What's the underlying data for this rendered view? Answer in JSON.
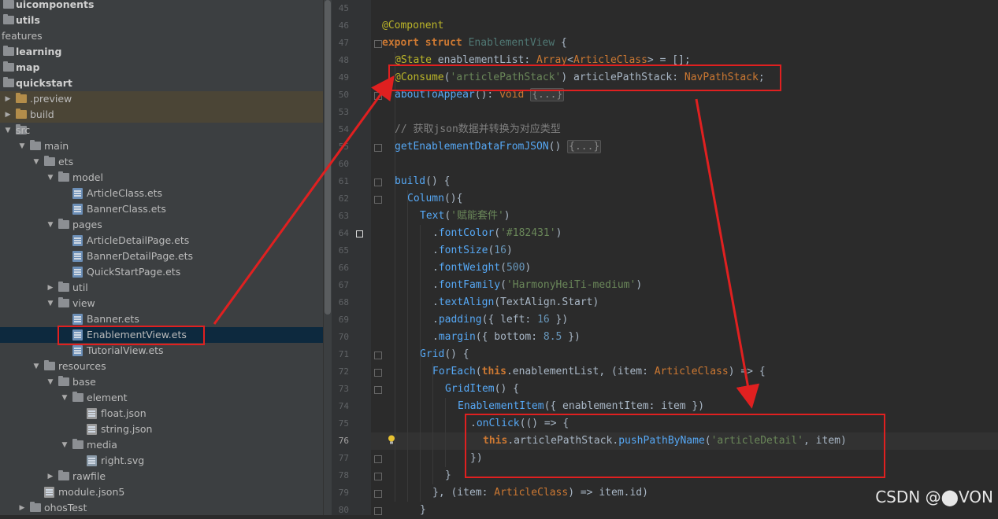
{
  "tree": [
    {
      "label": "uicomponents",
      "level": 0,
      "bold": true,
      "icon": "folder",
      "arrow": ""
    },
    {
      "label": "utils",
      "level": 0,
      "bold": true,
      "icon": "folder",
      "arrow": ""
    },
    {
      "label": "features",
      "level": -1,
      "bold": false,
      "icon": "none",
      "arrow": ""
    },
    {
      "label": "learning",
      "level": 0,
      "bold": true,
      "icon": "folder",
      "arrow": ""
    },
    {
      "label": "map",
      "level": 0,
      "bold": true,
      "icon": "folder",
      "arrow": ""
    },
    {
      "label": "quickstart",
      "level": 0,
      "bold": true,
      "icon": "folder",
      "arrow": ""
    },
    {
      "label": ".preview",
      "level": 0,
      "bold": false,
      "icon": "folder-orange",
      "arrow": "right",
      "hl": true
    },
    {
      "label": "build",
      "level": 0,
      "bold": false,
      "icon": "folder-orange",
      "arrow": "right",
      "hl": true
    },
    {
      "label": "src",
      "level": 0,
      "bold": false,
      "icon": "folder",
      "arrow": "down"
    },
    {
      "label": "main",
      "level": 1,
      "bold": false,
      "icon": "folder",
      "arrow": "down"
    },
    {
      "label": "ets",
      "level": 2,
      "bold": false,
      "icon": "folder",
      "arrow": "down"
    },
    {
      "label": "model",
      "level": 3,
      "bold": false,
      "icon": "folder",
      "arrow": "down"
    },
    {
      "label": "ArticleClass.ets",
      "level": 4,
      "bold": false,
      "icon": "file",
      "arrow": ""
    },
    {
      "label": "BannerClass.ets",
      "level": 4,
      "bold": false,
      "icon": "file",
      "arrow": ""
    },
    {
      "label": "pages",
      "level": 3,
      "bold": false,
      "icon": "folder",
      "arrow": "down"
    },
    {
      "label": "ArticleDetailPage.ets",
      "level": 4,
      "bold": false,
      "icon": "file",
      "arrow": ""
    },
    {
      "label": "BannerDetailPage.ets",
      "level": 4,
      "bold": false,
      "icon": "file",
      "arrow": ""
    },
    {
      "label": "QuickStartPage.ets",
      "level": 4,
      "bold": false,
      "icon": "file",
      "arrow": ""
    },
    {
      "label": "util",
      "level": 3,
      "bold": false,
      "icon": "folder",
      "arrow": "right"
    },
    {
      "label": "view",
      "level": 3,
      "bold": false,
      "icon": "folder",
      "arrow": "down"
    },
    {
      "label": "Banner.ets",
      "level": 4,
      "bold": false,
      "icon": "file",
      "arrow": ""
    },
    {
      "label": "EnablementView.ets",
      "level": 4,
      "bold": false,
      "icon": "file",
      "arrow": "",
      "sel": true
    },
    {
      "label": "TutorialView.ets",
      "level": 4,
      "bold": false,
      "icon": "file",
      "arrow": ""
    },
    {
      "label": "resources",
      "level": 2,
      "bold": false,
      "icon": "folder",
      "arrow": "down"
    },
    {
      "label": "base",
      "level": 3,
      "bold": false,
      "icon": "folder",
      "arrow": "down"
    },
    {
      "label": "element",
      "level": 4,
      "bold": false,
      "icon": "folder",
      "arrow": "down"
    },
    {
      "label": "float.json",
      "level": 5,
      "bold": false,
      "icon": "json",
      "arrow": ""
    },
    {
      "label": "string.json",
      "level": 5,
      "bold": false,
      "icon": "json",
      "arrow": ""
    },
    {
      "label": "media",
      "level": 4,
      "bold": false,
      "icon": "folder",
      "arrow": "down"
    },
    {
      "label": "right.svg",
      "level": 5,
      "bold": false,
      "icon": "svg",
      "arrow": ""
    },
    {
      "label": "rawfile",
      "level": 3,
      "bold": false,
      "icon": "folder",
      "arrow": "right"
    },
    {
      "label": "module.json5",
      "level": 2,
      "bold": false,
      "icon": "json",
      "arrow": ""
    },
    {
      "label": "ohosTest",
      "level": 1,
      "bold": false,
      "icon": "folder",
      "arrow": "right"
    }
  ],
  "line_numbers": [
    "45",
    "46",
    "47",
    "48",
    "49",
    "50",
    "53",
    "54",
    "55",
    "60",
    "61",
    "62",
    "63",
    "64",
    "65",
    "66",
    "67",
    "68",
    "69",
    "70",
    "71",
    "72",
    "73",
    "74",
    "75",
    "76",
    "77",
    "78",
    "79",
    "80"
  ],
  "current_line": "76",
  "code_lines": [
    {
      "indent": 0,
      "tokens": []
    },
    {
      "indent": 0,
      "tokens": [
        {
          "t": "@Component",
          "c": "ann"
        }
      ]
    },
    {
      "indent": 0,
      "tokens": [
        {
          "t": "export ",
          "c": "kw"
        },
        {
          "t": "struct ",
          "c": "kw"
        },
        {
          "t": "EnablementView",
          "c": "cls"
        },
        {
          "t": " {",
          "c": ""
        }
      ]
    },
    {
      "indent": 1,
      "tokens": [
        {
          "t": "@State ",
          "c": "ann"
        },
        {
          "t": "enablementList",
          "c": ""
        },
        {
          "t": ": ",
          "c": ""
        },
        {
          "t": "Array",
          "c": "typ"
        },
        {
          "t": "<",
          "c": ""
        },
        {
          "t": "ArticleClass",
          "c": "typ"
        },
        {
          "t": "> = [];",
          "c": ""
        }
      ]
    },
    {
      "indent": 1,
      "tokens": [
        {
          "t": "@Consume",
          "c": "ann"
        },
        {
          "t": "(",
          "c": ""
        },
        {
          "t": "'articlePathStack'",
          "c": "str"
        },
        {
          "t": ") articlePathStack: ",
          "c": ""
        },
        {
          "t": "NavPathStack",
          "c": "typ"
        },
        {
          "t": ";",
          "c": ""
        }
      ]
    },
    {
      "indent": 1,
      "tokens": [
        {
          "t": "aboutToAppear",
          "c": "fnb"
        },
        {
          "t": "(): ",
          "c": ""
        },
        {
          "t": "void ",
          "c": "kwn"
        },
        {
          "t": "{...}",
          "c": "fldb"
        }
      ]
    },
    {
      "indent": 0,
      "tokens": []
    },
    {
      "indent": 1,
      "tokens": [
        {
          "t": "// 获取json数据并转换为对应类型",
          "c": "cmt"
        }
      ]
    },
    {
      "indent": 1,
      "tokens": [
        {
          "t": "getEnablementDataFromJSON",
          "c": "fnb"
        },
        {
          "t": "() ",
          "c": ""
        },
        {
          "t": "{...}",
          "c": "fldb"
        }
      ]
    },
    {
      "indent": 0,
      "tokens": []
    },
    {
      "indent": 1,
      "tokens": [
        {
          "t": "build",
          "c": "fnb"
        },
        {
          "t": "() {",
          "c": ""
        }
      ]
    },
    {
      "indent": 2,
      "tokens": [
        {
          "t": "Column",
          "c": "fnb"
        },
        {
          "t": "(){",
          "c": ""
        }
      ]
    },
    {
      "indent": 3,
      "tokens": [
        {
          "t": "Text",
          "c": "fnb"
        },
        {
          "t": "(",
          "c": ""
        },
        {
          "t": "'赋能套件'",
          "c": "str"
        },
        {
          "t": ")",
          "c": ""
        }
      ]
    },
    {
      "indent": 4,
      "tokens": [
        {
          "t": ".",
          "c": ""
        },
        {
          "t": "fontColor",
          "c": "fnb"
        },
        {
          "t": "(",
          "c": ""
        },
        {
          "t": "'#182431'",
          "c": "str"
        },
        {
          "t": ")",
          "c": ""
        }
      ]
    },
    {
      "indent": 4,
      "tokens": [
        {
          "t": ".",
          "c": ""
        },
        {
          "t": "fontSize",
          "c": "fnb"
        },
        {
          "t": "(",
          "c": ""
        },
        {
          "t": "16",
          "c": "num"
        },
        {
          "t": ")",
          "c": ""
        }
      ]
    },
    {
      "indent": 4,
      "tokens": [
        {
          "t": ".",
          "c": ""
        },
        {
          "t": "fontWeight",
          "c": "fnb"
        },
        {
          "t": "(",
          "c": ""
        },
        {
          "t": "500",
          "c": "num"
        },
        {
          "t": ")",
          "c": ""
        }
      ]
    },
    {
      "indent": 4,
      "tokens": [
        {
          "t": ".",
          "c": ""
        },
        {
          "t": "fontFamily",
          "c": "fnb"
        },
        {
          "t": "(",
          "c": ""
        },
        {
          "t": "'HarmonyHeiTi-medium'",
          "c": "str"
        },
        {
          "t": ")",
          "c": ""
        }
      ]
    },
    {
      "indent": 4,
      "tokens": [
        {
          "t": ".",
          "c": ""
        },
        {
          "t": "textAlign",
          "c": "fnb"
        },
        {
          "t": "(TextAlign.Start)",
          "c": ""
        }
      ]
    },
    {
      "indent": 4,
      "tokens": [
        {
          "t": ".",
          "c": ""
        },
        {
          "t": "padding",
          "c": "fnb"
        },
        {
          "t": "({ left: ",
          "c": ""
        },
        {
          "t": "16",
          "c": "num"
        },
        {
          "t": " })",
          "c": ""
        }
      ]
    },
    {
      "indent": 4,
      "tokens": [
        {
          "t": ".",
          "c": ""
        },
        {
          "t": "margin",
          "c": "fnb"
        },
        {
          "t": "({ bottom: ",
          "c": ""
        },
        {
          "t": "8.5",
          "c": "num"
        },
        {
          "t": " })",
          "c": ""
        }
      ]
    },
    {
      "indent": 3,
      "tokens": [
        {
          "t": "Grid",
          "c": "fnb"
        },
        {
          "t": "() {",
          "c": ""
        }
      ]
    },
    {
      "indent": 4,
      "tokens": [
        {
          "t": "ForEach",
          "c": "fnb"
        },
        {
          "t": "(",
          "c": ""
        },
        {
          "t": "this",
          "c": "kw"
        },
        {
          "t": ".enablementList, (item: ",
          "c": ""
        },
        {
          "t": "ArticleClass",
          "c": "typ"
        },
        {
          "t": ") => {",
          "c": ""
        }
      ]
    },
    {
      "indent": 5,
      "tokens": [
        {
          "t": "GridItem",
          "c": "fnb"
        },
        {
          "t": "() {",
          "c": ""
        }
      ]
    },
    {
      "indent": 6,
      "tokens": [
        {
          "t": "EnablementItem",
          "c": "fnb"
        },
        {
          "t": "({ enablementItem: item })",
          "c": ""
        }
      ]
    },
    {
      "indent": 7,
      "tokens": [
        {
          "t": ".",
          "c": ""
        },
        {
          "t": "onClick",
          "c": "fnb"
        },
        {
          "t": "(() => {",
          "c": ""
        }
      ]
    },
    {
      "indent": 8,
      "tokens": [
        {
          "t": "this",
          "c": "kw"
        },
        {
          "t": ".articlePathStack.",
          "c": ""
        },
        {
          "t": "pushPathByName",
          "c": "fnb"
        },
        {
          "t": "(",
          "c": ""
        },
        {
          "t": "'articleDetail'",
          "c": "str"
        },
        {
          "t": ", item)",
          "c": ""
        }
      ]
    },
    {
      "indent": 7,
      "tokens": [
        {
          "t": "})",
          "c": ""
        }
      ]
    },
    {
      "indent": 5,
      "tokens": [
        {
          "t": "}",
          "c": ""
        }
      ]
    },
    {
      "indent": 4,
      "tokens": [
        {
          "t": "}, (item: ",
          "c": ""
        },
        {
          "t": "ArticleClass",
          "c": "typ"
        },
        {
          "t": ") => item.id)",
          "c": ""
        }
      ]
    },
    {
      "indent": 3,
      "tokens": [
        {
          "t": "}",
          "c": ""
        }
      ]
    }
  ],
  "watermark": "CSDN @⬤VON",
  "colors": {
    "annotation_red": "#e02020",
    "selection_bg": "#0d293e",
    "editor_bg": "#2b2b2b",
    "tree_bg": "#3c3f41"
  }
}
